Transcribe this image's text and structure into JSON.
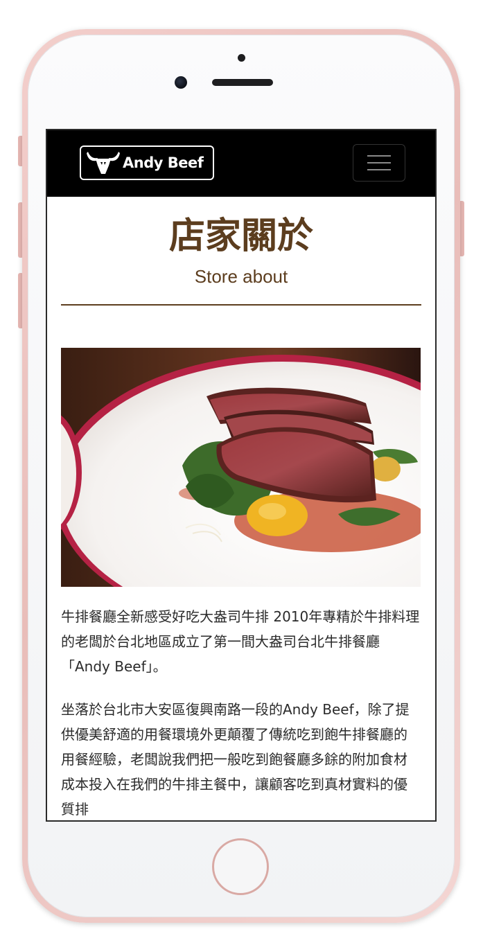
{
  "navbar": {
    "logo_text": "Andy Beef",
    "menu_toggle_label": "menu-icon"
  },
  "page": {
    "title": "店家關於",
    "subtitle": "Store about"
  },
  "about": {
    "paragraph_1": "牛排餐廳全新感受好吃大盎司牛排 2010年專精於牛排料理的老闆於台北地區成立了第一間大盎司台北牛排餐廳「Andy Beef」。",
    "paragraph_2": "坐落於台北市大安區復興南路一段的Andy Beef，除了提供優美舒適的用餐環境外更顛覆了傳統吃到飽牛排餐廳的用餐經驗，老闆說我們把一般吃到飽餐廳多餘的附加食材成本投入在我們的牛排主餐中，讓顧客吃到真材實料的優質排"
  },
  "colors": {
    "brand_brown": "#5c3d1e",
    "navbar_bg": "#000000",
    "phone_frame": "#f0c8c4"
  }
}
